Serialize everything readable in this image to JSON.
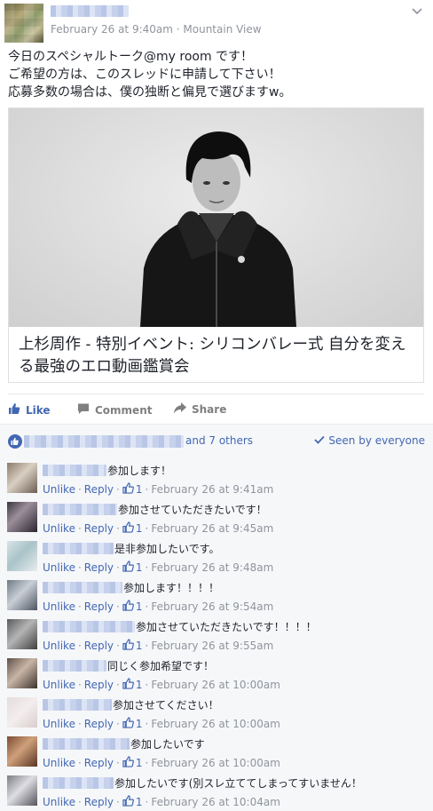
{
  "post": {
    "timestamp": "February 26 at 9:40am",
    "location": "Mountain View",
    "meta_separator": " · ",
    "text_lines": [
      "今日のスペシャルトーク@my room です！",
      "ご希望の方は、このスレッドに申請して下さい！",
      "応募多数の場合は、僕の独断と偏見で選びますw。"
    ]
  },
  "link_card": {
    "title": "上杉周作 - 特別イベント: シリコンバレー式 自分を変える最強のエロ動画鑑賞会"
  },
  "actions": {
    "like": "Like",
    "comment": "Comment",
    "share": "Share"
  },
  "likes_bar": {
    "others": "and 7 others",
    "seen_by": "Seen by everyone"
  },
  "comment_actions": {
    "unlike": "Unlike",
    "reply": "Reply",
    "separator": "·"
  },
  "comments": [
    {
      "text": "参加します！",
      "likes": "1",
      "time": "February 26 at 9:41am"
    },
    {
      "text": "参加させていただきたいです！",
      "likes": "1",
      "time": "February 26 at 9:45am"
    },
    {
      "text": "是非参加したいです。",
      "likes": "1",
      "time": "February 26 at 9:48am"
    },
    {
      "text": "参加します！！！！",
      "likes": "1",
      "time": "February 26 at 9:54am"
    },
    {
      "text": "参加させていただきたいです！！！！",
      "likes": "1",
      "time": "February 26 at 9:55am"
    },
    {
      "text": "同じく参加希望です！",
      "likes": "1",
      "time": "February 26 at 10:00am"
    },
    {
      "text": "参加させてください！",
      "likes": "1",
      "time": "February 26 at 10:00am"
    },
    {
      "text": "参加したいです",
      "likes": "1",
      "time": "February 26 at 10:00am"
    },
    {
      "text": "参加したいです(別スレ立ててしまってすいません！",
      "likes": "1",
      "time": "February 26 at 10:04am"
    }
  ],
  "colors": {
    "link_blue": "#4267b2",
    "meta_gray": "#90949c",
    "comment_bg": "#f6f7f9"
  }
}
